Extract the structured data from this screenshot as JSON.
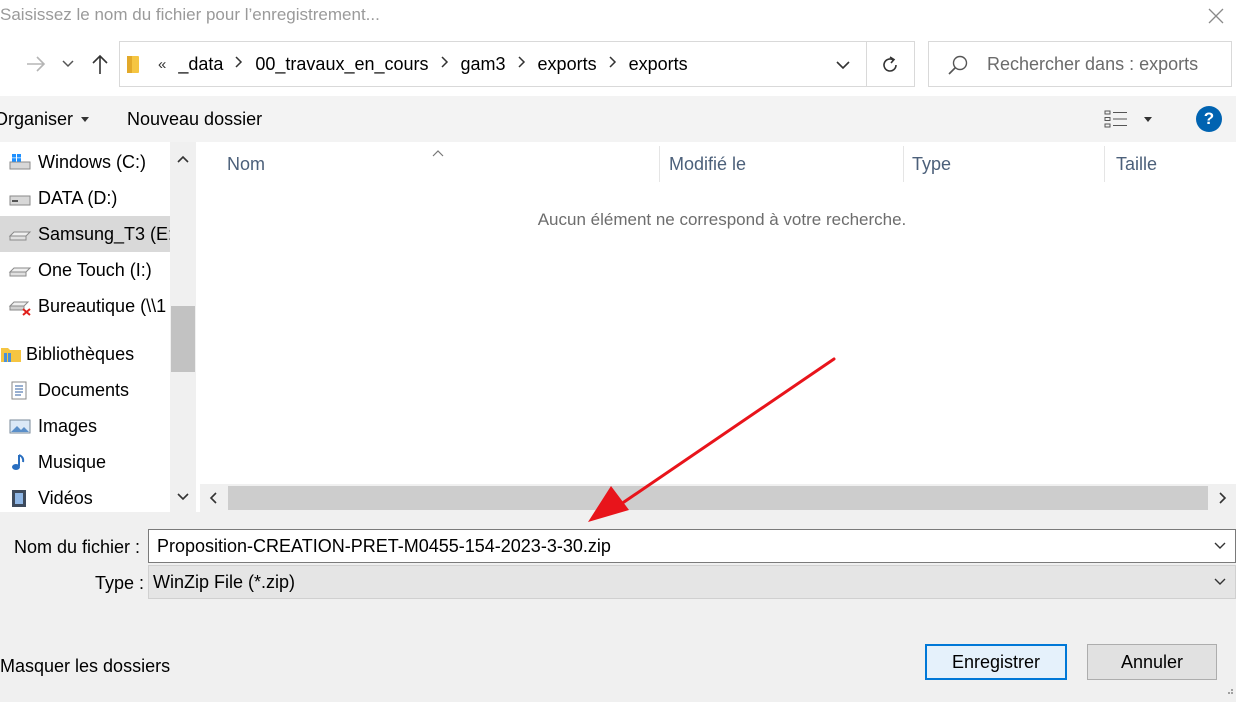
{
  "dialog": {
    "title": "Saisissez le nom du fichier pour l’enregistrement..."
  },
  "nav": {
    "breadcrumb_lead": "«",
    "crumbs": [
      "_data",
      "00_travaux_en_cours",
      "gam3",
      "exports",
      "exports"
    ],
    "search_placeholder": "Rechercher dans : exports"
  },
  "toolbar": {
    "organize_label": "Organiser",
    "new_folder_label": "Nouveau dossier",
    "help_label": "?"
  },
  "sidebar": {
    "items": [
      {
        "label": "Windows (C:)",
        "icon": "windows-drive-icon"
      },
      {
        "label": "DATA (D:)",
        "icon": "drive-icon"
      },
      {
        "label": "Samsung_T3 (E:)",
        "icon": "removable-drive-icon",
        "selected": true
      },
      {
        "label": "One Touch (I:)",
        "icon": "removable-drive-icon"
      },
      {
        "label": "Bureautique (\\\\1",
        "icon": "disconnected-network-drive-icon"
      },
      {
        "label": "Bibliothèques",
        "icon": "libraries-folder-icon"
      },
      {
        "label": "Documents",
        "icon": "documents-icon"
      },
      {
        "label": "Images",
        "icon": "pictures-icon"
      },
      {
        "label": "Musique",
        "icon": "music-icon"
      },
      {
        "label": "Vidéos",
        "icon": "videos-icon"
      }
    ]
  },
  "filelist": {
    "columns": [
      "Nom",
      "Modifié le",
      "Type",
      "Taille"
    ],
    "empty_message": "Aucun élément ne correspond à votre recherche."
  },
  "form": {
    "filename_label": "Nom du fichier :",
    "filename_value": "Proposition-CREATION-PRET-M0455-154-2023-3-30.zip",
    "type_label": "Type :",
    "type_value": "WinZip File (*.zip)",
    "hide_folders_label": "Masquer les dossiers",
    "save_label": "Enregistrer",
    "cancel_label": "Annuler"
  },
  "colors": {
    "accent": "#0078d7",
    "help_bg": "#0063b1",
    "annotation_arrow": "#e8141b"
  }
}
